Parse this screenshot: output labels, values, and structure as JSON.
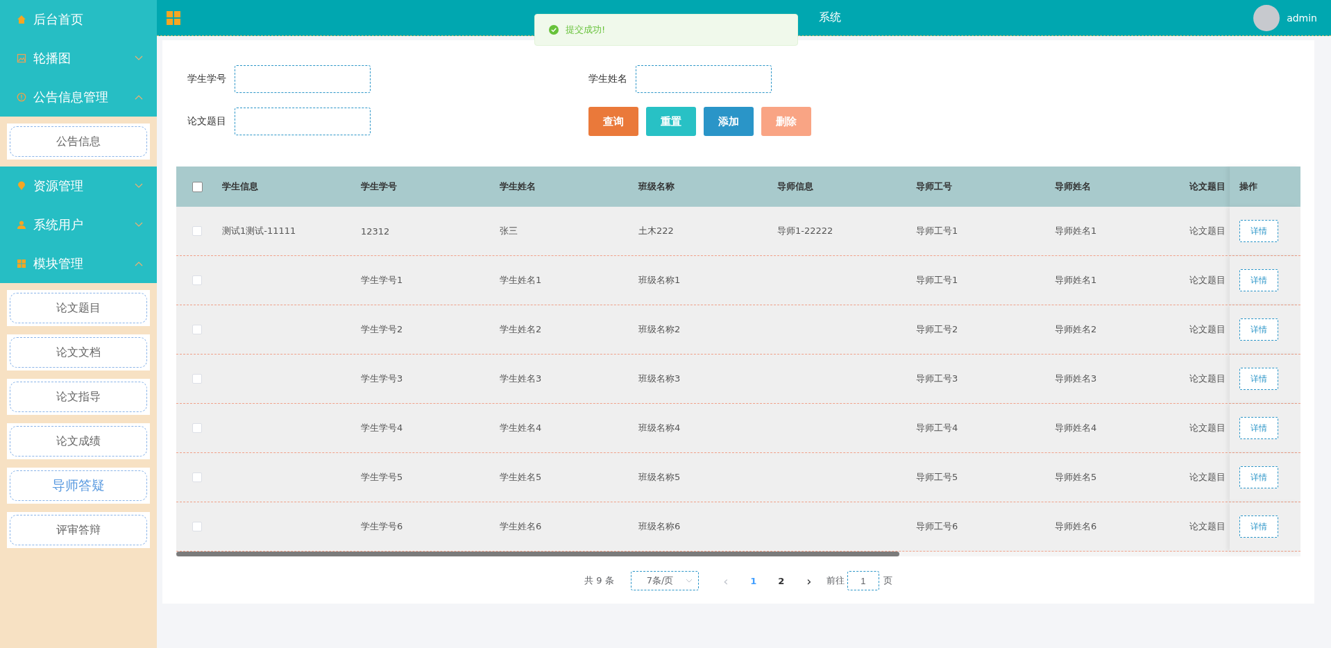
{
  "sidebar": {
    "items": [
      {
        "kind": "link",
        "label": "后台首页"
      },
      {
        "kind": "group",
        "label": "轮播图",
        "expanded": false
      },
      {
        "kind": "group",
        "label": "公告信息管理",
        "expanded": true,
        "children": [
          {
            "label": "公告信息",
            "selected": false
          }
        ]
      },
      {
        "kind": "group",
        "label": "资源管理",
        "expanded": false
      },
      {
        "kind": "group",
        "label": "系统用户",
        "expanded": false
      },
      {
        "kind": "group",
        "label": "模块管理",
        "expanded": true,
        "children": [
          {
            "label": "论文题目",
            "selected": false
          },
          {
            "label": "论文文档",
            "selected": false
          },
          {
            "label": "论文指导",
            "selected": false
          },
          {
            "label": "论文成绩",
            "selected": false
          },
          {
            "label": "导师答疑",
            "selected": true
          },
          {
            "label": "评审答辩",
            "selected": false
          }
        ]
      }
    ]
  },
  "header": {
    "title": "系统",
    "user": "admin"
  },
  "toast": {
    "message": "提交成功!"
  },
  "search_form": {
    "fields": [
      {
        "label": "学生学号"
      },
      {
        "label": "学生姓名"
      },
      {
        "label": "论文题目"
      }
    ],
    "buttons": [
      {
        "label": "查询",
        "color": "#ea793a"
      },
      {
        "label": "重置",
        "color": "#28c1c5"
      },
      {
        "label": "添加",
        "color": "#2a95c8"
      },
      {
        "label": "删除",
        "color": "#f9a484"
      }
    ]
  },
  "table": {
    "select_all": {
      "checked": false
    },
    "columns": [
      "学生信息",
      "学生学号",
      "学生姓名",
      "班级名称",
      "导师信息",
      "导师工号",
      "导师姓名",
      "论文题目"
    ],
    "action_column": "操作",
    "rows": [
      {
        "checked": false,
        "cells": [
          "测试1测试-11111",
          "12312",
          "张三",
          "土木222",
          "导师1-22222",
          "导师工号1",
          "导师姓名1",
          "论文题目"
        ],
        "action": "详情"
      },
      {
        "checked": false,
        "cells": [
          null,
          "学生学号1",
          "学生姓名1",
          "班级名称1",
          null,
          "导师工号1",
          "导师姓名1",
          "论文题目"
        ],
        "action": "详情"
      },
      {
        "checked": false,
        "cells": [
          null,
          "学生学号2",
          "学生姓名2",
          "班级名称2",
          null,
          "导师工号2",
          "导师姓名2",
          "论文题目"
        ],
        "action": "详情"
      },
      {
        "checked": false,
        "cells": [
          null,
          "学生学号3",
          "学生姓名3",
          "班级名称3",
          null,
          "导师工号3",
          "导师姓名3",
          "论文题目"
        ],
        "action": "详情"
      },
      {
        "checked": false,
        "cells": [
          null,
          "学生学号4",
          "学生姓名4",
          "班级名称4",
          null,
          "导师工号4",
          "导师姓名4",
          "论文题目"
        ],
        "action": "详情"
      },
      {
        "checked": false,
        "cells": [
          null,
          "学生学号5",
          "学生姓名5",
          "班级名称5",
          null,
          "导师工号5",
          "导师姓名5",
          "论文题目"
        ],
        "action": "详情"
      },
      {
        "checked": false,
        "cells": [
          null,
          "学生学号6",
          "学生姓名6",
          "班级名称6",
          null,
          "导师工号6",
          "导师姓名6",
          "论文题目"
        ],
        "action": "详情"
      }
    ]
  },
  "pagination": {
    "total": "共 9 条",
    "page_size": "7条/页",
    "prev": "‹",
    "pages": [
      {
        "label": "1",
        "selected": true
      },
      {
        "label": "2",
        "selected": false
      }
    ],
    "next": "›",
    "goto_label": "前往",
    "goto_value": "1",
    "goto_suffix": "页"
  }
}
